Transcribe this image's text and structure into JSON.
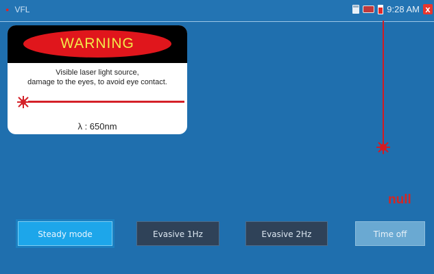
{
  "status_bar": {
    "app_title": "VFL",
    "time": "9:28 AM",
    "close_label": "x"
  },
  "warning": {
    "header": "WARNING",
    "line1": "Visible laser light source,",
    "line2": "damage to the eyes, to avoid eye contact.",
    "wavelength": "λ : 650nm"
  },
  "status_value": "null",
  "buttons": {
    "steady": "Steady mode",
    "evasive_1hz": "Evasive 1Hz",
    "evasive_2hz": "Evasive 2Hz",
    "time_off": "Time off"
  },
  "colors": {
    "background": "#1f6fae",
    "laser_red": "#d42028",
    "active_button": "#1da6ea"
  }
}
